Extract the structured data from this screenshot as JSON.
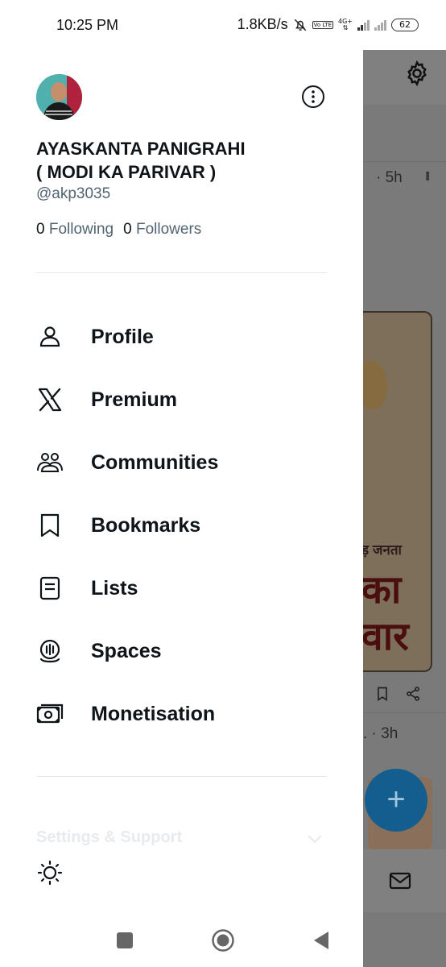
{
  "status_bar": {
    "time": "10:25 PM",
    "net_speed": "1.8KB/s",
    "network_badge": "4G+",
    "volte_badge": "Vo LTE",
    "battery": "62"
  },
  "drawer": {
    "user": {
      "display_name_line1": "AYASKANTA PANIGRAHI",
      "display_name_line2": "( MODI KA PARIVAR )",
      "handle": "@akp3035",
      "following_count": "0",
      "following_label": "Following",
      "followers_count": "0",
      "followers_label": "Followers"
    },
    "menu": [
      {
        "label": "Profile",
        "icon": "person-icon"
      },
      {
        "label": "Premium",
        "icon": "x-logo-icon"
      },
      {
        "label": "Communities",
        "icon": "communities-icon"
      },
      {
        "label": "Bookmarks",
        "icon": "bookmark-icon"
      },
      {
        "label": "Lists",
        "icon": "list-icon"
      },
      {
        "label": "Spaces",
        "icon": "spaces-icon"
      },
      {
        "label": "Monetisation",
        "icon": "money-icon"
      }
    ],
    "settings_label": "Settings & Support",
    "theme_icon": "sun-icon"
  },
  "background_app": {
    "timestamp_1": "· 5h",
    "timestamp_2": ". · 3h",
    "card_text_1": "ड़ जनता",
    "card_text_2": "का",
    "card_text_3": "वार",
    "fab_label": "+"
  },
  "colors": {
    "primary_text": "#0f1419",
    "secondary_text": "#536471",
    "fab": "#135e8f",
    "overlay": "#7a7a7a"
  }
}
